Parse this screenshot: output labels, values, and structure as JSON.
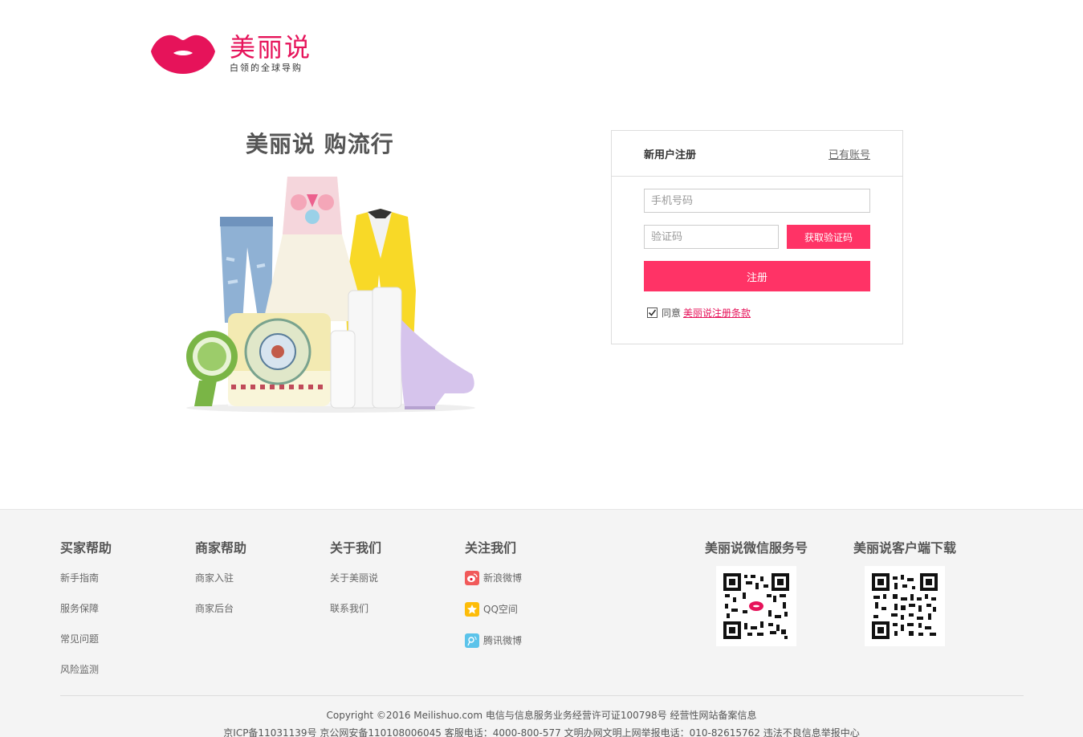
{
  "brand": {
    "name": "美丽说",
    "tagline": "白领的全球导购",
    "accent_color": "#e6135a",
    "button_color": "#ff3366"
  },
  "promo": {
    "title": "美丽说 购流行",
    "image_icon": "fashion-products-illustration"
  },
  "register": {
    "title": "新用户注册",
    "login_link": "已有账号",
    "phone_placeholder": "手机号码",
    "code_placeholder": "验证码",
    "get_code_button": "获取验证码",
    "submit_button": "注册",
    "agree_text": "同意",
    "agree_checked": true,
    "terms_link": "美丽说注册条款"
  },
  "footer": {
    "columns": [
      {
        "title": "买家帮助",
        "items": [
          "新手指南",
          "服务保障",
          "常见问题",
          "风险监测"
        ]
      },
      {
        "title": "商家帮助",
        "items": [
          "商家入驻",
          "商家后台"
        ]
      },
      {
        "title": "关于我们",
        "items": [
          "关于美丽说",
          "联系我们"
        ]
      }
    ],
    "social": {
      "title": "关注我们",
      "items": [
        {
          "label": "新浪微博",
          "icon": "weibo-icon",
          "color": "#e6162d"
        },
        {
          "label": "QQ空间",
          "icon": "qzone-icon",
          "color": "#fdbc08"
        },
        {
          "label": "腾讯微博",
          "icon": "tencent-weibo-icon",
          "color": "#4fc1e9"
        }
      ]
    },
    "qr": [
      {
        "title": "美丽说微信服务号",
        "icon": "wechat-qr-code"
      },
      {
        "title": "美丽说客户端下载",
        "icon": "app-download-qr-code"
      }
    ],
    "copyright_line1": "Copyright ©2016 Meilishuo.com  电信与信息服务业务经营许可证100798号 经营性网站备案信息",
    "copyright_line2": "京ICP备11031139号  京公网安备110108006045   客服电话：4000-800-577   文明办网文明上网举报电话：010-82615762  违法不良信息举报中心"
  }
}
